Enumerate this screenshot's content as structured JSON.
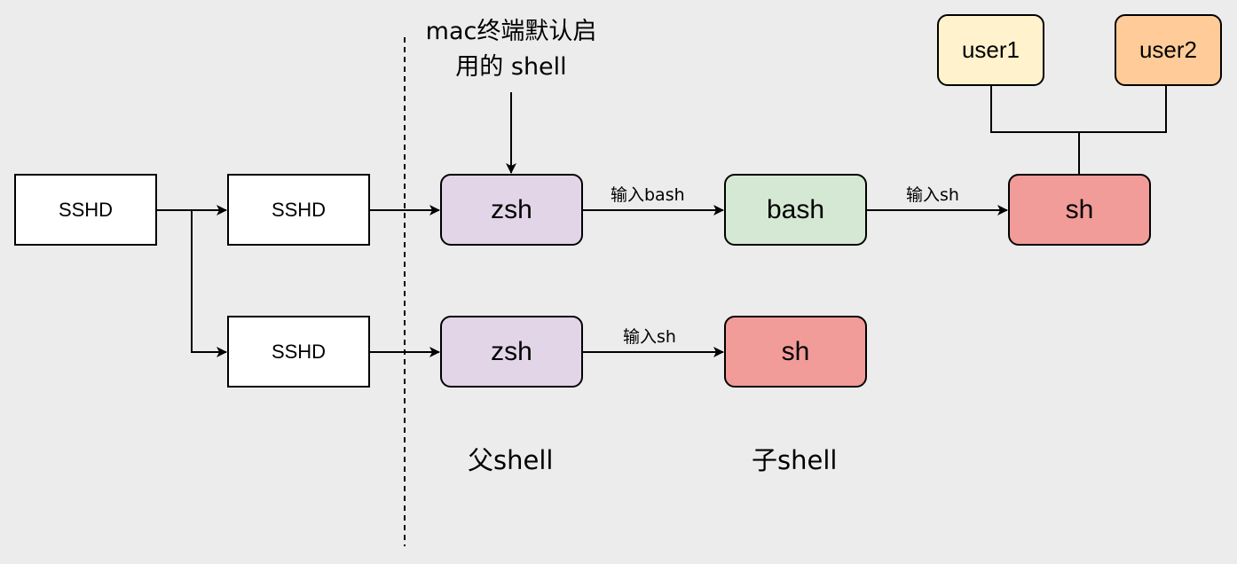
{
  "colors": {
    "plain": "#ffffff",
    "zsh": "#e1d5e7",
    "bash": "#d5e8d4",
    "sh": "#f19c99",
    "user1": "#fff2cc",
    "user2": "#ffcc99",
    "line": "#000000"
  },
  "nodes": {
    "sshd_root": "SSHD",
    "sshd_a": "SSHD",
    "sshd_b": "SSHD",
    "zsh_a": "zsh",
    "bash": "bash",
    "sh_a": "sh",
    "zsh_b": "zsh",
    "sh_b": "sh",
    "user1": "user1",
    "user2": "user2"
  },
  "edge_labels": {
    "zsh_to_bash": "输入bash",
    "bash_to_sh": "输入sh",
    "zsh_to_sh": "输入sh"
  },
  "annotation": {
    "line1": "mac终端默认启",
    "line2": "用的 shell"
  },
  "captions": {
    "parent": "父shell",
    "child": "子shell"
  }
}
